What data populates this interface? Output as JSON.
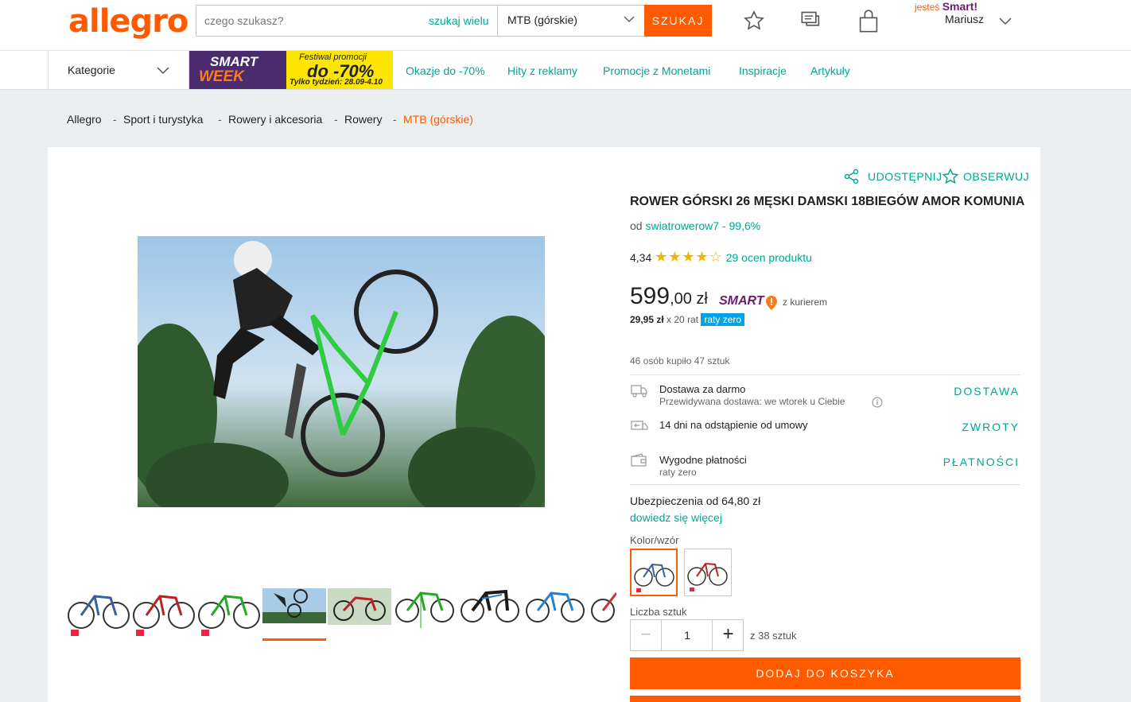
{
  "header": {
    "logo": "allegro",
    "search": {
      "placeholder": "czego szukasz?",
      "many": "szukaj wielu",
      "category": "MTB (górskie)",
      "button": "SZUKAJ"
    },
    "smart": {
      "prefix": "jesteś",
      "brand": "Smart!"
    },
    "user": "Mariusz"
  },
  "nav": {
    "categories": "Kategorie",
    "promo": {
      "smart": "SMART",
      "week": "WEEK",
      "festival": "Festiwal promocji",
      "discount": "do -70%",
      "dates": "Tylko tydzień: 28.09-4.10"
    },
    "links": [
      "Okazje do -70%",
      "Hity z reklamy",
      "Promocje z Monetami",
      "Inspiracje",
      "Artykuły"
    ]
  },
  "breadcrumb": [
    "Allegro",
    "Sport i turystyka",
    "Rowery i akcesoria",
    "Rowery",
    "MTB (górskie)"
  ],
  "product": {
    "share": "UDOSTĘPNIJ",
    "watch": "OBSERWUJ",
    "title": "ROWER GÓRSKI 26 MĘSKI DAMSKI 18BIEGÓW AMOR KOMUNIA",
    "seller_prefix": "od",
    "seller": "swiatrowerow7 - 99,6%",
    "rating_value": "4,34",
    "rating_stars": 4.34,
    "rating_count": "29 ocen produktu",
    "price_main": "599",
    "price_cents": ",00 zł",
    "smart_badge": "SMART",
    "courier": "z kurierem",
    "installment_amount": "29,95 zł",
    "installment_rest": "x 20 rat",
    "installment_badge": "raty zero",
    "sold": "46 osób kupiło 47 sztuk",
    "delivery": {
      "title": "Dostawa za darmo",
      "sub": "Przewidywana dostawa: we wtorek u Ciebie",
      "link": "DOSTAWA"
    },
    "returns": {
      "title": "14 dni na odstąpienie od umowy",
      "link": "ZWROTY"
    },
    "payment": {
      "title": "Wygodne płatności",
      "sub": "raty zero",
      "link": "PŁATNOŚCI"
    },
    "insurance": "Ubezpieczenia od 64,80 zł",
    "insurance_more": "dowiedz się więcej",
    "color_label": "Kolor/wzór",
    "qty_label": "Liczba sztuk",
    "qty": "1",
    "qty_of": "z 38 sztuk",
    "add_to_cart": "DODAJ DO KOSZYKA"
  },
  "colors": {
    "accent": "#ff5a00",
    "link": "#00a790",
    "smart": "#6c1b6f",
    "raty": "#00a4e4",
    "star": "#f5b301"
  }
}
